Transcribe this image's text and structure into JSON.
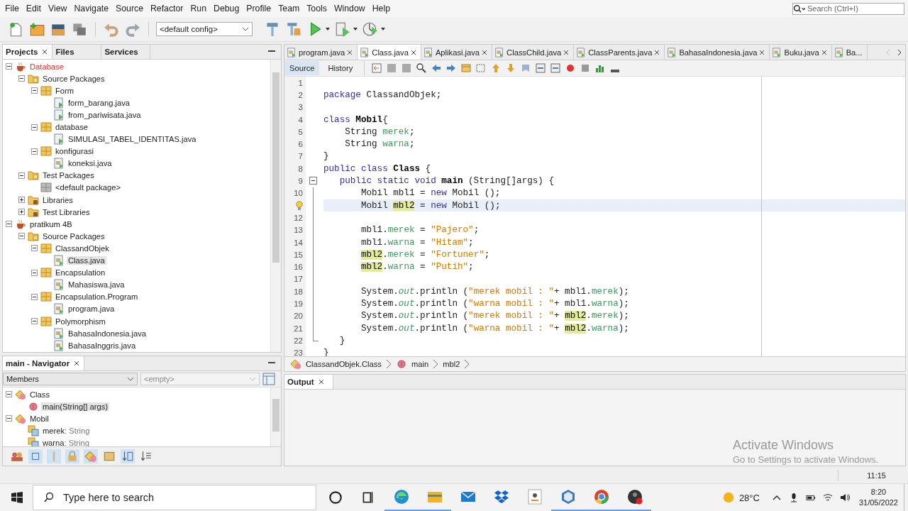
{
  "menu": [
    "File",
    "Edit",
    "View",
    "Navigate",
    "Source",
    "Refactor",
    "Run",
    "Debug",
    "Profile",
    "Team",
    "Tools",
    "Window",
    "Help"
  ],
  "search": {
    "placeholder": "Search (Ctrl+I)"
  },
  "toolbar": {
    "config": "<default config>"
  },
  "projects_panel": {
    "tabs": [
      {
        "label": "Projects",
        "selected": true
      },
      {
        "label": "Files",
        "selected": false
      },
      {
        "label": "Services",
        "selected": false
      }
    ],
    "tree": [
      {
        "label": "Database",
        "kind": "project",
        "error": true,
        "expanded": true,
        "selected": false,
        "children": [
          {
            "label": "Source Packages",
            "kind": "source-packages",
            "expanded": true,
            "selected": false,
            "children": [
              {
                "label": "Form",
                "kind": "package",
                "expanded": true,
                "selected": false,
                "children": [
                  {
                    "label": "form_barang.java",
                    "kind": "form-file",
                    "selected": false
                  },
                  {
                    "label": "from_pariwisata.java",
                    "kind": "form-file",
                    "selected": false
                  }
                ]
              },
              {
                "label": "database",
                "kind": "package",
                "expanded": true,
                "selected": false,
                "children": [
                  {
                    "label": "SIMULASI_TABEL_IDENTITAS.java",
                    "kind": "form-file",
                    "selected": false
                  }
                ]
              },
              {
                "label": "konfigurasi",
                "kind": "package",
                "expanded": true,
                "selected": false,
                "children": [
                  {
                    "label": "koneksi.java",
                    "kind": "java-file",
                    "selected": false
                  }
                ]
              }
            ]
          },
          {
            "label": "Test Packages",
            "kind": "source-packages",
            "expanded": true,
            "selected": false,
            "children": [
              {
                "label": "<default package>",
                "kind": "default-package",
                "selected": false
              }
            ]
          },
          {
            "label": "Libraries",
            "kind": "libraries",
            "expanded": false,
            "selected": false
          },
          {
            "label": "Test Libraries",
            "kind": "libraries",
            "expanded": false,
            "selected": false
          }
        ]
      },
      {
        "label": "pratikum 4B",
        "kind": "project",
        "error": false,
        "expanded": true,
        "selected": false,
        "children": [
          {
            "label": "Source Packages",
            "kind": "source-packages",
            "expanded": true,
            "selected": false,
            "children": [
              {
                "label": "ClassandObjek",
                "kind": "package",
                "expanded": true,
                "selected": false,
                "children": [
                  {
                    "label": "Class.java",
                    "kind": "java-file",
                    "selected": true
                  }
                ]
              },
              {
                "label": "Encapsulation",
                "kind": "package",
                "expanded": true,
                "selected": false,
                "children": [
                  {
                    "label": "Mahasiswa.java",
                    "kind": "java-file",
                    "selected": false
                  }
                ]
              },
              {
                "label": "Encapsulation.Program",
                "kind": "package",
                "expanded": true,
                "selected": false,
                "children": [
                  {
                    "label": "program.java",
                    "kind": "java-file",
                    "selected": false
                  }
                ]
              },
              {
                "label": "Polymorphism",
                "kind": "package",
                "expanded": true,
                "selected": false,
                "children": [
                  {
                    "label": "BahasaIndonesia.java",
                    "kind": "java-file",
                    "selected": false
                  },
                  {
                    "label": "BahasaInggris.java",
                    "kind": "java-file",
                    "selected": false
                  }
                ]
              }
            ]
          }
        ]
      }
    ]
  },
  "navigator": {
    "title": "main - Navigator",
    "filter": "Members",
    "second_filter": "<empty>",
    "tree": [
      {
        "label": "Class",
        "kind": "class",
        "expanded": true,
        "selected": false,
        "children": [
          {
            "label": "main(String[] args)",
            "kind": "method",
            "selected": true
          }
        ]
      },
      {
        "label": "Mobil",
        "kind": "class",
        "expanded": true,
        "selected": false,
        "children": [
          {
            "label": "merek",
            "type": ": String",
            "kind": "field",
            "selected": false
          },
          {
            "label": "warna",
            "type": ": String",
            "kind": "field",
            "selected": false
          }
        ]
      }
    ]
  },
  "editor": {
    "tabs": [
      {
        "label": "program.java",
        "selected": false
      },
      {
        "label": "Class.java",
        "selected": true
      },
      {
        "label": "Aplikasi.java",
        "selected": false
      },
      {
        "label": "ClassChild.java",
        "selected": false
      },
      {
        "label": "ClassParents.java",
        "selected": false
      },
      {
        "label": "BahasaIndonesia.java",
        "selected": false
      },
      {
        "label": "Buku.java",
        "selected": false
      },
      {
        "label": "Ba...",
        "selected": false
      }
    ],
    "views": [
      {
        "label": "Source",
        "selected": true
      },
      {
        "label": "History",
        "selected": false
      }
    ],
    "lines": [
      {
        "number": "1",
        "current": false
      },
      {
        "number": "2",
        "current": false,
        "tokens": [
          {
            "text": "package",
            "kind": "keyword"
          },
          {
            "text": " ClassandObjek;",
            "kind": "plain"
          }
        ]
      },
      {
        "number": "3",
        "current": false
      },
      {
        "number": "4",
        "current": false,
        "tokens": [
          {
            "text": "class ",
            "kind": "keyword"
          },
          {
            "text": "Mobil",
            "kind": "name"
          },
          {
            "text": "{",
            "kind": "plain"
          }
        ]
      },
      {
        "number": "5",
        "current": false,
        "tokens": [
          {
            "text": "    String ",
            "kind": "plain"
          },
          {
            "text": "merek",
            "kind": "field"
          },
          {
            "text": ";",
            "kind": "plain"
          }
        ]
      },
      {
        "number": "6",
        "current": false,
        "tokens": [
          {
            "text": "    String ",
            "kind": "plain"
          },
          {
            "text": "warna",
            "kind": "field"
          },
          {
            "text": ";",
            "kind": "plain"
          }
        ]
      },
      {
        "number": "7",
        "current": false,
        "tokens": [
          {
            "text": "}",
            "kind": "plain"
          }
        ]
      },
      {
        "number": "8",
        "current": false,
        "tokens": [
          {
            "text": "public class ",
            "kind": "keyword"
          },
          {
            "text": "Class",
            "kind": "name"
          },
          {
            "text": " {",
            "kind": "plain"
          }
        ]
      },
      {
        "number": "9",
        "current": false,
        "kind": "fold-start",
        "tokens": [
          {
            "text": "   public static void ",
            "kind": "keyword"
          },
          {
            "text": "main",
            "kind": "name"
          },
          {
            "text": " (String[]args) {",
            "kind": "plain"
          }
        ]
      },
      {
        "number": "10",
        "current": false,
        "tokens": [
          {
            "text": "       Mobil mbl1 = ",
            "kind": "plain"
          },
          {
            "text": "new",
            "kind": "keyword"
          },
          {
            "text": " Mobil ();",
            "kind": "plain"
          }
        ]
      },
      {
        "current": true,
        "kind": "hint",
        "tokens": [
          {
            "text": "       Mobil ",
            "kind": "plain"
          },
          {
            "text": "mbl2",
            "kind": "mark"
          },
          {
            "text": " = ",
            "kind": "plain"
          },
          {
            "text": "new",
            "kind": "keyword"
          },
          {
            "text": " Mobil ();",
            "kind": "plain"
          }
        ]
      },
      {
        "number": "12",
        "current": false
      },
      {
        "number": "13",
        "current": false,
        "tokens": [
          {
            "text": "       mbl1.",
            "kind": "plain"
          },
          {
            "text": "merek",
            "kind": "field"
          },
          {
            "text": " = ",
            "kind": "plain"
          },
          {
            "text": "\"Pajero\"",
            "kind": "string"
          },
          {
            "text": ";",
            "kind": "plain"
          }
        ]
      },
      {
        "number": "14",
        "current": false,
        "tokens": [
          {
            "text": "       mbl1.",
            "kind": "plain"
          },
          {
            "text": "warna",
            "kind": "field"
          },
          {
            "text": " = ",
            "kind": "plain"
          },
          {
            "text": "\"Hitam\"",
            "kind": "string"
          },
          {
            "text": ";",
            "kind": "plain"
          }
        ]
      },
      {
        "number": "15",
        "current": false,
        "tokens": [
          {
            "text": "       mbl2",
            "kind": "mark"
          },
          {
            "text": ".",
            "kind": "plain"
          },
          {
            "text": "merek",
            "kind": "field"
          },
          {
            "text": " = ",
            "kind": "plain"
          },
          {
            "text": "\"Fortuner\"",
            "kind": "string"
          },
          {
            "text": ";",
            "kind": "plain"
          }
        ]
      },
      {
        "number": "16",
        "current": false,
        "tokens": [
          {
            "text": "       mbl2",
            "kind": "mark"
          },
          {
            "text": ".",
            "kind": "plain"
          },
          {
            "text": "warna",
            "kind": "field"
          },
          {
            "text": " = ",
            "kind": "plain"
          },
          {
            "text": "\"Putih\"",
            "kind": "string"
          },
          {
            "text": ";",
            "kind": "plain"
          }
        ]
      },
      {
        "number": "17",
        "current": false
      },
      {
        "number": "18",
        "current": false,
        "tokens": [
          {
            "text": "       System.",
            "kind": "plain"
          },
          {
            "text": "out",
            "kind": "static"
          },
          {
            "text": ".println (",
            "kind": "plain"
          },
          {
            "text": "\"merek mobil : \"",
            "kind": "string"
          },
          {
            "text": "+ mbl1.",
            "kind": "plain"
          },
          {
            "text": "merek",
            "kind": "field"
          },
          {
            "text": ");",
            "kind": "plain"
          }
        ]
      },
      {
        "number": "19",
        "current": false,
        "tokens": [
          {
            "text": "       System.",
            "kind": "plain"
          },
          {
            "text": "out",
            "kind": "static"
          },
          {
            "text": ".println (",
            "kind": "plain"
          },
          {
            "text": "\"warna mobil : \"",
            "kind": "string"
          },
          {
            "text": "+ mbl1.",
            "kind": "plain"
          },
          {
            "text": "warna",
            "kind": "field"
          },
          {
            "text": ");",
            "kind": "plain"
          }
        ]
      },
      {
        "number": "20",
        "current": false,
        "tokens": [
          {
            "text": "       System.",
            "kind": "plain"
          },
          {
            "text": "out",
            "kind": "static"
          },
          {
            "text": ".println (",
            "kind": "plain"
          },
          {
            "text": "\"merek mobil : \"",
            "kind": "string"
          },
          {
            "text": "+ ",
            "kind": "plain"
          },
          {
            "text": "mbl2",
            "kind": "mark"
          },
          {
            "text": ".",
            "kind": "plain"
          },
          {
            "text": "merek",
            "kind": "field"
          },
          {
            "text": ");",
            "kind": "plain"
          }
        ]
      },
      {
        "number": "21",
        "current": false,
        "tokens": [
          {
            "text": "       System.",
            "kind": "plain"
          },
          {
            "text": "out",
            "kind": "static"
          },
          {
            "text": ".println (",
            "kind": "plain"
          },
          {
            "text": "\"warna mobil : \"",
            "kind": "string"
          },
          {
            "text": "+ ",
            "kind": "plain"
          },
          {
            "text": "mbl2",
            "kind": "mark"
          },
          {
            "text": ".",
            "kind": "plain"
          },
          {
            "text": "warna",
            "kind": "field"
          },
          {
            "text": ");",
            "kind": "plain"
          }
        ]
      },
      {
        "number": "22",
        "current": false,
        "kind": "fold-end",
        "tokens": [
          {
            "text": "   }",
            "kind": "plain"
          }
        ]
      },
      {
        "number": "23",
        "current": false,
        "tokens": [
          {
            "text": "}",
            "kind": "plain"
          }
        ]
      }
    ],
    "breadcrumb": [
      {
        "label": "ClassandObjek.Class",
        "kind": "class"
      },
      {
        "label": "main",
        "kind": "method"
      },
      {
        "label": "mbl2",
        "kind": "variable"
      }
    ]
  },
  "output": {
    "title": "Output"
  },
  "activation_notice": {
    "title": "Activate Windows",
    "text": "Go to Settings to activate Windows."
  },
  "status_bar": {
    "position": "11:15"
  },
  "taskbar": {
    "search_placeholder": "Type here to search",
    "apps": [
      {
        "kind": "edge",
        "running": true
      },
      {
        "kind": "explorer",
        "running": true
      },
      {
        "kind": "mail",
        "running": false
      },
      {
        "kind": "dropbox",
        "running": false
      },
      {
        "kind": "amazon",
        "running": false
      },
      {
        "kind": "cube",
        "running": true
      },
      {
        "kind": "chrome",
        "running": true
      },
      {
        "kind": "recorder",
        "running": true
      }
    ],
    "weather": "28°C",
    "time": "8:20",
    "date": "31/05/2022"
  }
}
